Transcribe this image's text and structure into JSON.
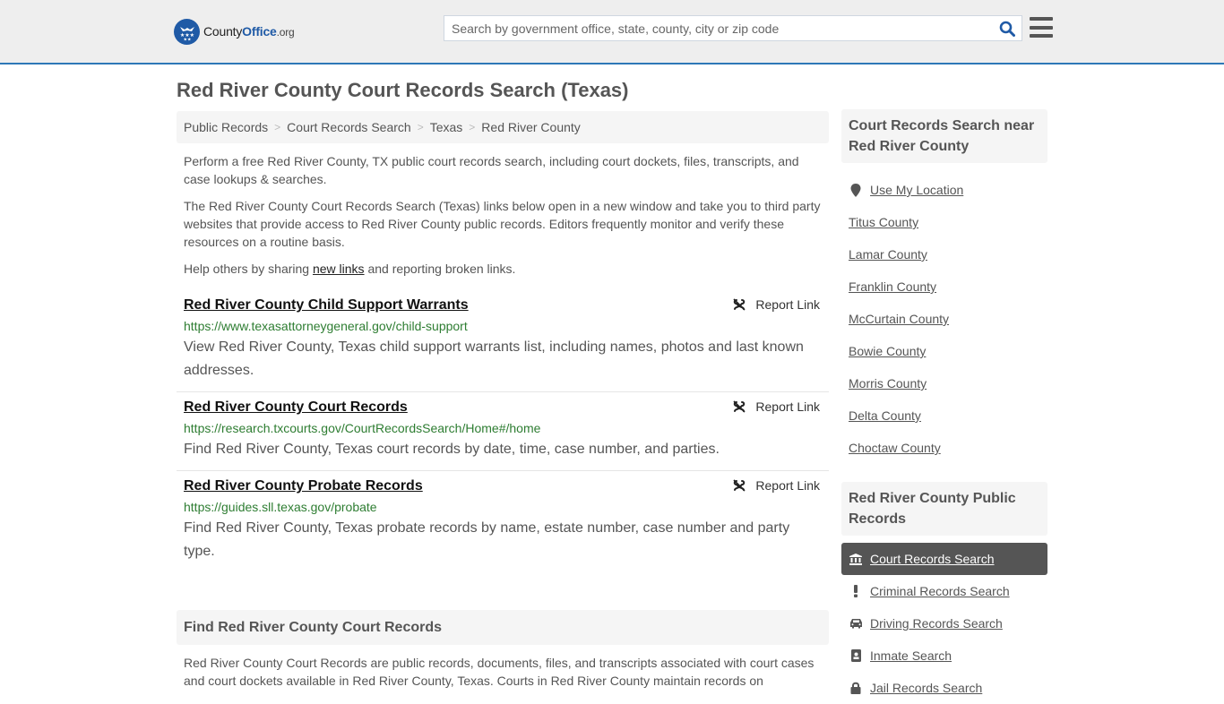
{
  "header": {
    "logo": {
      "part1": "County",
      "part2": "Office",
      "part3": ".org"
    },
    "search": {
      "placeholder": "Search by government office, state, county, city or zip code",
      "value": ""
    },
    "icons": {
      "search": "search-icon",
      "menu": "hamburger-menu-icon"
    }
  },
  "page": {
    "title": "Red River County Court Records Search (Texas)"
  },
  "breadcrumb": [
    {
      "label": "Public Records"
    },
    {
      "label": "Court Records Search"
    },
    {
      "label": "Texas"
    },
    {
      "label": "Red River County"
    }
  ],
  "intro": {
    "p1": "Perform a free Red River County, TX public court records search, including court dockets, files, transcripts, and case lookups & searches.",
    "p2": "The Red River County Court Records Search (Texas) links below open in a new window and take you to third party websites that provide access to Red River County public records. Editors frequently monitor and verify these resources on a routine basis.",
    "p3_before": "Help others by sharing ",
    "p3_link": "new links",
    "p3_after": " and reporting broken links."
  },
  "links": [
    {
      "title": "Red River County Child Support Warrants",
      "url": "https://www.texasattorneygeneral.gov/child-support",
      "description": "View Red River County, Texas child support warrants list, including names, photos and last known addresses.",
      "report_label": "Report Link"
    },
    {
      "title": "Red River County Court Records",
      "url": "https://research.txcourts.gov/CourtRecordsSearch/Home#/home",
      "description": "Find Red River County, Texas court records by date, time, case number, and parties.",
      "report_label": "Report Link"
    },
    {
      "title": "Red River County Probate Records",
      "url": "https://guides.sll.texas.gov/probate",
      "description": "Find Red River County, Texas probate records by name, estate number, case number and party type.",
      "report_label": "Report Link"
    }
  ],
  "find_section": {
    "heading": "Find Red River County Court Records",
    "body": "Red River County Court Records are public records, documents, files, and transcripts associated with court cases and court dockets available in Red River County, Texas. Courts in Red River County maintain records on"
  },
  "sidebar": {
    "nearby_heading": "Court Records Search near Red River County",
    "use_location": "Use My Location",
    "nearby": [
      {
        "label": "Titus County"
      },
      {
        "label": "Lamar County"
      },
      {
        "label": "Franklin County"
      },
      {
        "label": "McCurtain County"
      },
      {
        "label": "Bowie County"
      },
      {
        "label": "Morris County"
      },
      {
        "label": "Delta County"
      },
      {
        "label": "Choctaw County"
      }
    ],
    "public_heading": "Red River County Public Records",
    "public": [
      {
        "label": "Court Records Search",
        "icon": "courthouse-icon",
        "active": true
      },
      {
        "label": "Criminal Records Search",
        "icon": "exclamation-icon",
        "active": false
      },
      {
        "label": "Driving Records Search",
        "icon": "car-icon",
        "active": false
      },
      {
        "label": "Inmate Search",
        "icon": "id-badge-icon",
        "active": false
      },
      {
        "label": "Jail Records Search",
        "icon": "lock-icon",
        "active": false
      }
    ]
  },
  "colors": {
    "brand_blue": "#1f5aa6",
    "header_border": "#2e78b7",
    "url_green": "#2e7d32",
    "active_bg": "#555555"
  }
}
